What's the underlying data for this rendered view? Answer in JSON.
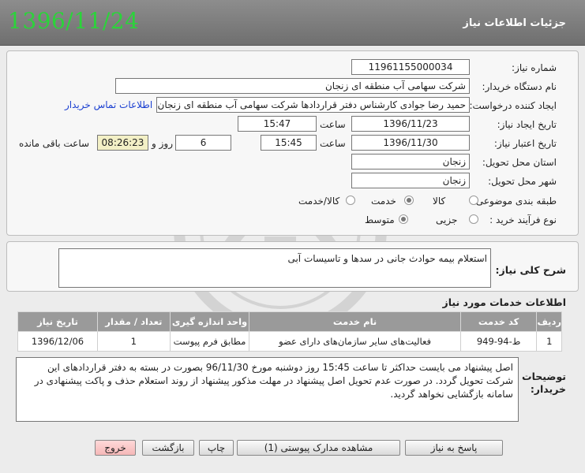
{
  "header": {
    "title": "جزئیات اطلاعات نیاز",
    "date": "1396/11/24"
  },
  "form": {
    "need_number_label": "شماره نیاز:",
    "need_number": "1196115500003‌4",
    "buyer_org_label": "نام دستگاه خریدار:",
    "buyer_org": "شرکت سهامی آب منطقه ای زنجان",
    "creator_label": "ایجاد کننده درخواست:",
    "creator": "حمید رضا جوادی کارشناس دفتر قراردادها شرکت سهامی آب منطقه ای زنجان",
    "contact_link": "اطلاعات تماس خریدار",
    "created_date_label": "تاریخ ایجاد نیاز:",
    "created_date": "1396/11/23",
    "time_label": "ساعت",
    "created_time": "15:47",
    "validity_label": "تاریخ اعتبار نیاز:",
    "validity_date": "1396/11/30",
    "validity_time": "15:45",
    "days_value": "6",
    "days_label": "روز و",
    "remaining_time": "08:26:23",
    "remaining_label": "ساعت باقی مانده",
    "province_label": "استان محل تحویل:",
    "province": "زنجان",
    "city_label": "شهر محل تحویل:",
    "city": "زنجان",
    "category_label": "طبقه بندی موضوعی:",
    "category_options": [
      "کالا",
      "خدمت",
      "کالا/خدمت"
    ],
    "category_selected": "خدمت",
    "process_label": "نوع فرآیند خرید :",
    "process_options": [
      "جزیی",
      "متوسط"
    ],
    "process_selected": "متوسط"
  },
  "summary": {
    "label": "شرح کلی نیاز:",
    "text": "استعلام بیمه حوادث جانی در سدها و تاسیسات آبی"
  },
  "services": {
    "title": "اطلاعات خدمات مورد نیاز",
    "columns": [
      "ردیف",
      "کد خدمت",
      "نام خدمت",
      "واحد اندازه گیری",
      "تعداد / مقدار",
      "تاریخ نیاز"
    ],
    "rows": [
      [
        "1",
        "ط-94-949",
        "فعالیت‌های سایر سازمان‌های دارای عضو",
        "مطابق فرم پیوست",
        "1",
        "1396/12/06"
      ]
    ]
  },
  "notes": {
    "label": "توضیحات خریدار:",
    "text": "اصل پیشنهاد می بایست حداکثر تا ساعت 15:45 روز دوشنبه مورخ 96/11/30 بصورت در بسته به دفتر قراردادهای این شرکت تحویل گردد. در صورت عدم تحویل اصل پیشنهاد در مهلت مذکور پیشنهاد از روند استعلام حذف و پاکت پیشنهادی در سامانه بازگشایی نخواهد گردید."
  },
  "buttons": {
    "reply": "پاسخ به نیاز",
    "attachments": "مشاهده مدارک پیوستی (1)",
    "print": "چاپ",
    "back": "بازگشت",
    "exit": "خروج"
  },
  "colors": {
    "date_green": "#2bd43a",
    "header_gray": "#7d7d7d",
    "table_header": "#9a9a9a"
  }
}
